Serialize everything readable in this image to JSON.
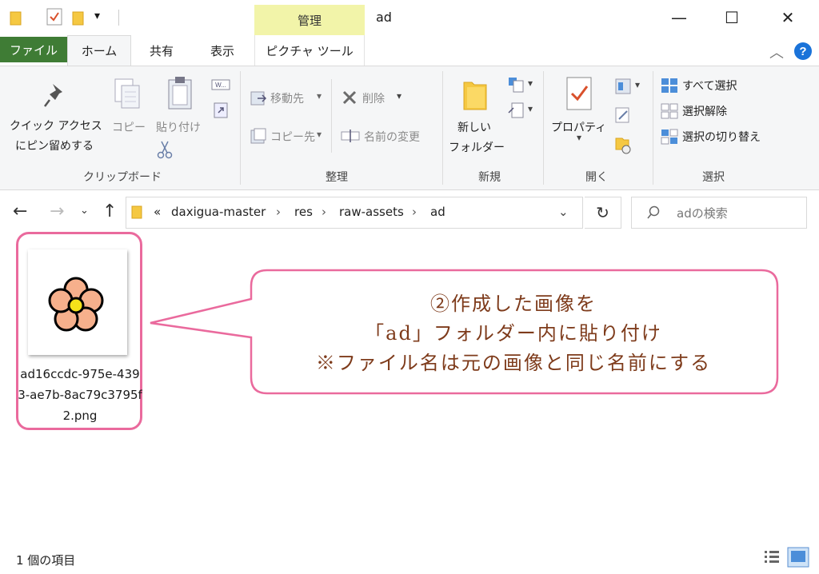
{
  "titlebar": {
    "contextual_tab": "管理",
    "title": "ad",
    "min_symbol": "—",
    "max_symbol": "☐",
    "close_symbol": "✕"
  },
  "tabs": {
    "file": "ファイル",
    "home": "ホーム",
    "share": "共有",
    "view": "表示",
    "picture_tools": "ピクチャ ツール"
  },
  "ribbon": {
    "clipboard": {
      "pin_line1": "クイック アクセス",
      "pin_line2": "にピン留めする",
      "copy": "コピー",
      "paste": "貼り付け",
      "label": "クリップボード"
    },
    "organize": {
      "move_to": "移動先",
      "copy_to": "コピー先",
      "delete": "削除",
      "rename": "名前の変更",
      "label": "整理"
    },
    "new": {
      "new_folder_line1": "新しい",
      "new_folder_line2": "フォルダー",
      "label": "新規"
    },
    "open": {
      "properties": "プロパティ",
      "label": "開く"
    },
    "select": {
      "select_all": "すべて選択",
      "select_none": "選択解除",
      "invert": "選択の切り替え",
      "label": "選択"
    }
  },
  "address": {
    "overflow": "«",
    "crumbs": [
      "daxigua-master",
      "res",
      "raw-assets",
      "ad"
    ],
    "search_placeholder": "adの検索"
  },
  "file": {
    "name": "ad16ccdc-975e-4393-ae7b-8ac79c3795f2.png"
  },
  "callout": {
    "line1": "②作成した画像を",
    "line2": "「ad」フォルダー内に貼り付け",
    "line3": "※ファイル名は元の画像と同じ名前にする"
  },
  "status": {
    "count": "1 個の項目"
  },
  "colors": {
    "file_tab": "#3f7c35",
    "contextual_tab": "#f2f4a9",
    "highlight": "#ea6a9d",
    "callout_text": "#7e3b1b",
    "help": "#1a73d9"
  }
}
